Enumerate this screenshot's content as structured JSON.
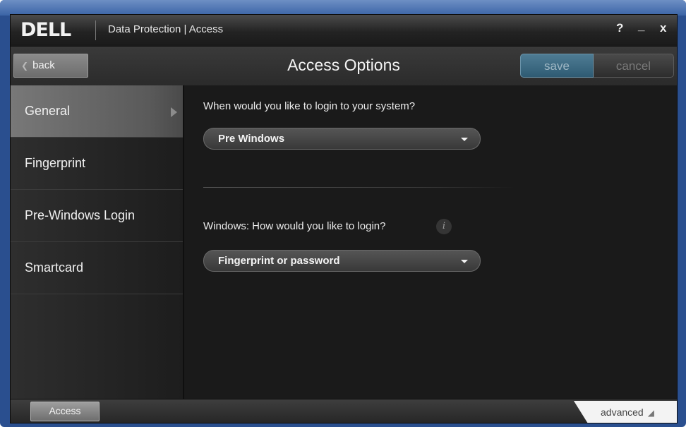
{
  "titlebar": {
    "brand": "DELL",
    "app_title": "Data Protection | Access",
    "help_label": "?",
    "minimize_label": "_",
    "close_label": "x"
  },
  "header": {
    "back_label": "back",
    "page_title": "Access Options",
    "save_label": "save",
    "cancel_label": "cancel"
  },
  "sidebar": {
    "items": [
      {
        "label": "General",
        "selected": true
      },
      {
        "label": "Fingerprint"
      },
      {
        "label": "Pre-Windows Login"
      },
      {
        "label": "Smartcard"
      }
    ]
  },
  "main": {
    "question1": "When would you like to login to your system?",
    "dropdown1_value": "Pre Windows",
    "question2": "Windows:  How would you like to login?",
    "info_icon_label": "i",
    "dropdown2_value": "Fingerprint or password"
  },
  "footer": {
    "access_tab": "Access",
    "advanced_label": "advanced"
  },
  "colors": {
    "save_accent": "#3e6b84",
    "background": "#1a1a1a",
    "selected_nav": "#6c6c6c"
  }
}
